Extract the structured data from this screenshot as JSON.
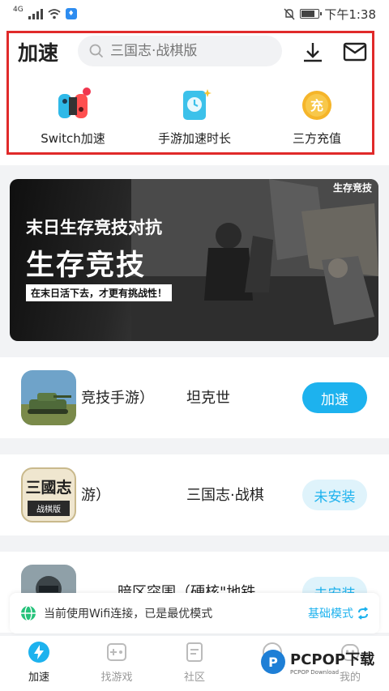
{
  "status_bar": {
    "network": "4G",
    "time": "下午1:38"
  },
  "header": {
    "title": "加速",
    "search_placeholder": "三国志·战棋版",
    "quick_actions": [
      {
        "label": "Switch加速",
        "icon": "switch-controller-icon"
      },
      {
        "label": "手游加速时长",
        "icon": "phone-clock-icon"
      },
      {
        "label": "三方充值",
        "icon": "recharge-coin-icon",
        "glyph": "充"
      }
    ]
  },
  "banner": {
    "subtitle": "末日生存竞技对抗",
    "title": "生存竞技",
    "tag": "在末日活下去，才更有挑战性！",
    "corner_label": "生存竞技"
  },
  "games": [
    {
      "name_part1": "竞技手游）",
      "name_part2": "坦克世",
      "action": "加速",
      "icon": "tank-game-icon"
    },
    {
      "name_part1": "游）",
      "name_part2": "三国志·战棋",
      "action": "未安装",
      "icon": "sanguozhi-game-icon",
      "icon_text": "三國志",
      "icon_sub": "战棋版"
    },
    {
      "name_part1": "暗区突围（硬核\"地铁",
      "name_part2": "",
      "action": "未安装",
      "icon": "soldier-game-icon"
    }
  ],
  "notice": {
    "text": "当前使用Wifi连接，已是最优模式",
    "mode": "基础模式"
  },
  "tabs": [
    {
      "label": "加速",
      "icon": "bolt-icon"
    },
    {
      "label": "找游戏",
      "icon": "gamepad-icon"
    },
    {
      "label": "社区",
      "icon": "document-icon"
    },
    {
      "label": "",
      "icon": "flower-icon"
    },
    {
      "label": "我的",
      "icon": "face-icon"
    }
  ],
  "watermark": {
    "main": "PCPOP下载",
    "sub": "PCPOP Download"
  },
  "colors": {
    "accent": "#1db2ee",
    "highlight": "#e02a2a"
  }
}
